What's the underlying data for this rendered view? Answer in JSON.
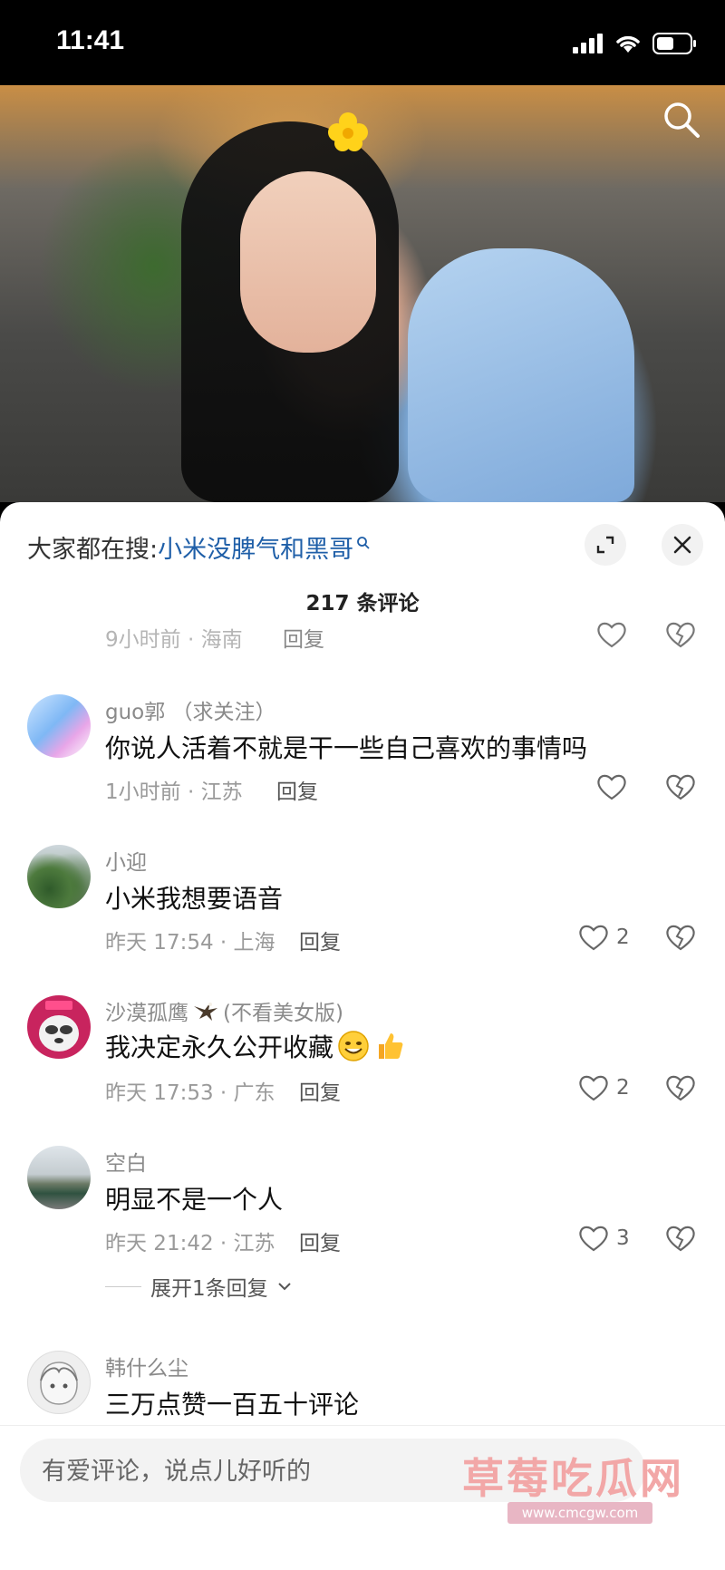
{
  "status": {
    "time": "11:41"
  },
  "sheet": {
    "hot_search_prefix": "大家都在搜:",
    "hot_search_keyword": "小米没脾气和黑哥",
    "comment_count": "217 条评论"
  },
  "comments": [
    {
      "meta": "9小时前 · 海南",
      "reply": "回复"
    },
    {
      "name": "guo郭 （求关注）",
      "text": "你说人活着不就是干一些自己喜欢的事情吗",
      "meta": "1小时前 · 江苏",
      "reply": "回复"
    },
    {
      "name": "小迎",
      "text": "小米我想要语音",
      "meta": "昨天 17:54 · 上海",
      "reply": "回复",
      "likes": "2"
    },
    {
      "name": "沙漠孤鹰",
      "name_suffix": "(不看美女版)",
      "text": "我决定永久公开收藏",
      "meta": "昨天 17:53 · 广东",
      "reply": "回复",
      "likes": "2"
    },
    {
      "name": "空白",
      "text": "明显不是一个人",
      "meta": "昨天 21:42 · 江苏",
      "reply": "回复",
      "likes": "3",
      "expand": "展开1条回复"
    },
    {
      "name": "韩什么尘",
      "text": "三万点赞一百五十评论"
    }
  ],
  "input": {
    "placeholder": "有爱评论，说点儿好听的"
  },
  "watermark": {
    "title": "草莓吃瓜网",
    "url": "www.cmcgw.com"
  }
}
